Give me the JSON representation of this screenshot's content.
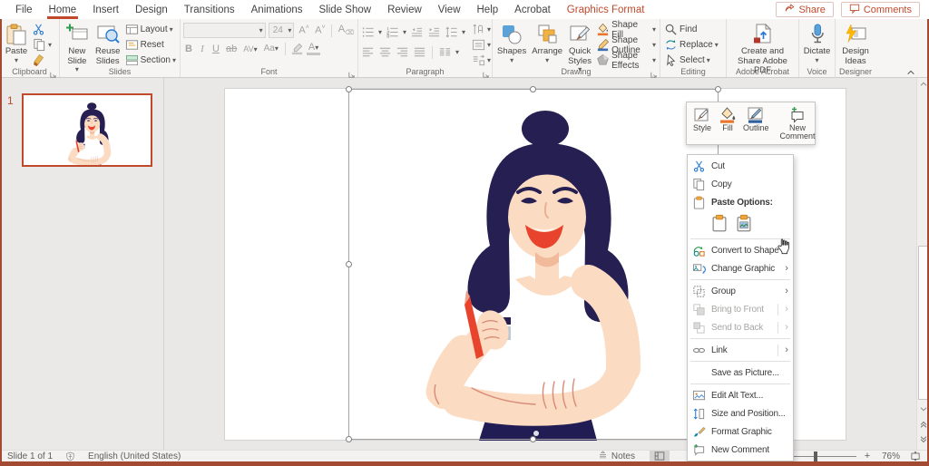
{
  "accent_color": "#c0492c",
  "menu_bar": {
    "tabs": [
      {
        "label": "File"
      },
      {
        "label": "Home",
        "active": true
      },
      {
        "label": "Insert"
      },
      {
        "label": "Design"
      },
      {
        "label": "Transitions"
      },
      {
        "label": "Animations"
      },
      {
        "label": "Slide Show"
      },
      {
        "label": "Review"
      },
      {
        "label": "View"
      },
      {
        "label": "Help"
      },
      {
        "label": "Acrobat"
      },
      {
        "label": "Graphics Format",
        "contextual": true
      }
    ],
    "share_label": "Share",
    "comments_label": "Comments"
  },
  "ribbon": {
    "clipboard": {
      "label": "Clipboard",
      "paste": "Paste",
      "cut": "Cut",
      "copy": "Copy",
      "format_painter": "Format Painter"
    },
    "slides": {
      "label": "Slides",
      "new_slide": "New Slide",
      "reuse_slides": "Reuse Slides",
      "layout": "Layout",
      "reset": "Reset",
      "section": "Section"
    },
    "font": {
      "label": "Font",
      "size": "24",
      "bold": "B",
      "italic": "I",
      "underline": "U",
      "strike": "S",
      "strike2": "ab",
      "spacing": "AV",
      "case": "Aa",
      "color": "A",
      "grow": "A",
      "shrink": "A"
    },
    "paragraph": {
      "label": "Paragraph"
    },
    "drawing": {
      "label": "Drawing",
      "shapes": "Shapes",
      "arrange": "Arrange",
      "quick_styles": "Quick Styles",
      "shape_fill": "Shape Fill",
      "shape_outline": "Shape Outline",
      "shape_effects": "Shape Effects"
    },
    "editing": {
      "label": "Editing",
      "find": "Find",
      "replace": "Replace",
      "select": "Select"
    },
    "adobe": {
      "label": "Adobe Acrobat",
      "button": "Create and Share Adobe PDF"
    },
    "voice": {
      "label": "Voice",
      "dictate": "Dictate"
    },
    "designer": {
      "label": "Designer",
      "button": "Design Ideas"
    }
  },
  "thumbnail_panel": {
    "slide_number": "1"
  },
  "mini_toolbar": {
    "items": [
      {
        "label": "Style",
        "icon": "mini-style",
        "caret": true
      },
      {
        "label": "Fill",
        "icon": "mini-fill",
        "caret": true
      },
      {
        "label": "Outline",
        "icon": "mini-outline",
        "caret": true
      },
      {
        "label": "New Comment",
        "icon": "mini-comment",
        "caret": false,
        "separated": true
      }
    ]
  },
  "context_menu": {
    "items": [
      {
        "label": "Cut",
        "icon": "scissors",
        "enabled": true
      },
      {
        "label": "Copy",
        "icon": "copy",
        "enabled": true
      },
      {
        "label": "Paste Options:",
        "icon": "clipboard",
        "enabled": true,
        "bold": true
      },
      {
        "type": "paste-row",
        "options": [
          "clipboard",
          "clipboard-pic"
        ]
      },
      {
        "type": "separator"
      },
      {
        "label": "Convert to Shape",
        "icon": "convert-shape",
        "enabled": true
      },
      {
        "label": "Change Graphic",
        "icon": "change-graphic",
        "enabled": true,
        "submenu": true
      },
      {
        "type": "separator"
      },
      {
        "label": "Group",
        "icon": "group",
        "enabled": true,
        "submenu": true
      },
      {
        "label": "Bring to Front",
        "icon": "bring-front",
        "enabled": false,
        "submenu": true,
        "pipe": true
      },
      {
        "label": "Send to Back",
        "icon": "send-back",
        "enabled": false,
        "submenu": true,
        "pipe": true
      },
      {
        "type": "separator"
      },
      {
        "label": "Link",
        "icon": "link",
        "enabled": true,
        "submenu": true,
        "pipe": true
      },
      {
        "type": "separator"
      },
      {
        "label": "Save as Picture...",
        "icon": null,
        "enabled": true
      },
      {
        "type": "separator"
      },
      {
        "label": "Edit Alt Text...",
        "icon": "alt-text",
        "enabled": true
      },
      {
        "label": "Size and Position...",
        "icon": "size-position",
        "enabled": true
      },
      {
        "label": "Format Graphic",
        "icon": "format-graphic",
        "enabled": true
      },
      {
        "label": "New Comment",
        "icon": "new-comment",
        "enabled": true
      }
    ]
  },
  "status_bar": {
    "slide_indicator": "Slide 1 of 1",
    "language": "English (United States)",
    "notes_label": "Notes",
    "zoom_level": "76%"
  }
}
